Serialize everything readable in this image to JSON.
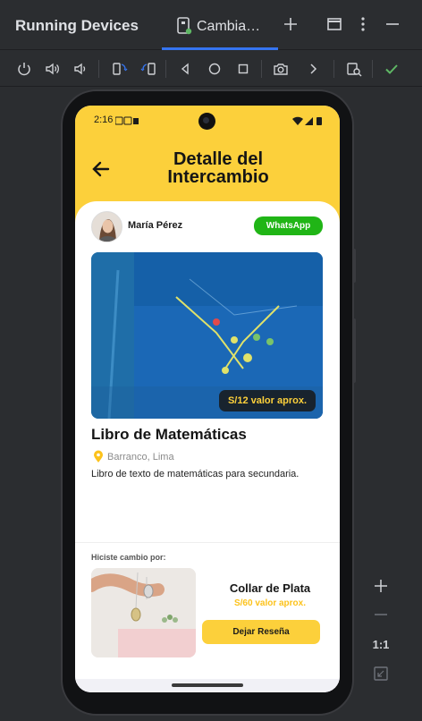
{
  "tool_window": {
    "title": "Running Devices",
    "tab_label": "Cambia…",
    "header_buttons": [
      "add-icon",
      "window-icon",
      "more-vertical-icon",
      "minimize-icon"
    ]
  },
  "toolbar": {
    "icons": [
      "power-icon",
      "volume-up-icon",
      "volume-down-icon",
      "rotate-left-icon",
      "rotate-right-icon",
      "back-icon",
      "home-icon",
      "overview-icon",
      "screenshot-icon",
      "chevron-right-icon",
      "device-explorer-icon",
      "check-icon"
    ],
    "accent": "#3574f0",
    "check_color": "#5fb865"
  },
  "zoom": {
    "zoom_in": "+",
    "zoom_out": "−",
    "actual_size": "1:1"
  },
  "device": {
    "status_time": "2:16",
    "app": {
      "title": "Detalle del Intercambio",
      "header_color": "#fcd03b",
      "user": {
        "name": "María Pérez",
        "whatsapp_label": "WhatsApp"
      },
      "item": {
        "value_tag": "S/12 valor aprox.",
        "title": "Libro de Matemáticas",
        "location": "Barranco, Lima",
        "description": "Libro de texto de matemáticas para secundaria."
      },
      "swap": {
        "label": "Hiciste cambio por:",
        "title": "Collar de Plata",
        "value": "S/60 valor aprox.",
        "review_button": "Dejar Reseña"
      }
    }
  }
}
